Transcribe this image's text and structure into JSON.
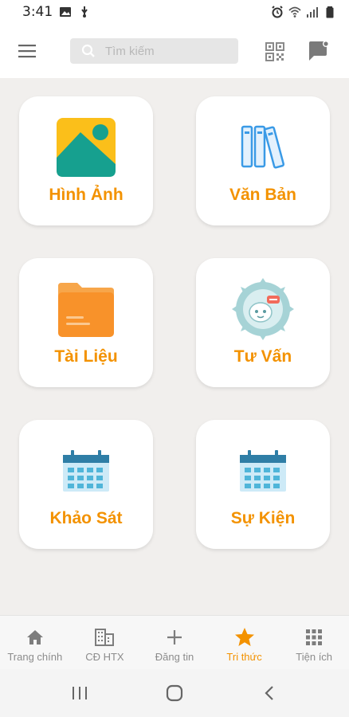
{
  "status_bar": {
    "time": "3:41",
    "left_icons": [
      "image-icon",
      "usb-icon"
    ],
    "right_icons": [
      "alarm-icon",
      "wifi-icon",
      "signal-icon",
      "battery-icon"
    ]
  },
  "toolbar": {
    "search_placeholder": "Tìm kiếm",
    "menu_icon": "hamburger-menu-icon",
    "qr_icon": "qr-code-icon",
    "message_icon": "message-icon"
  },
  "tiles": [
    {
      "label": "Hình Ảnh",
      "icon": "image-icon"
    },
    {
      "label": "Văn Bản",
      "icon": "books-icon"
    },
    {
      "label": "Tài Liệu",
      "icon": "folder-icon"
    },
    {
      "label": "Tư Vấn",
      "icon": "chat-bot-icon"
    },
    {
      "label": "Khảo Sát",
      "icon": "calendar-icon"
    },
    {
      "label": "Sự Kiện",
      "icon": "calendar-icon"
    }
  ],
  "bottom_nav": [
    {
      "label": "Trang chính",
      "icon": "home-icon",
      "active": false
    },
    {
      "label": "CĐ HTX",
      "icon": "building-icon",
      "active": false
    },
    {
      "label": "Đăng tin",
      "icon": "plus-icon",
      "active": false
    },
    {
      "label": "Tri thức",
      "icon": "star-icon",
      "active": true
    },
    {
      "label": "Tiện ích",
      "icon": "grid-icon",
      "active": false
    }
  ],
  "colors": {
    "accent": "#f39200",
    "inactive": "#8c8c8c",
    "background": "#f1efed"
  }
}
